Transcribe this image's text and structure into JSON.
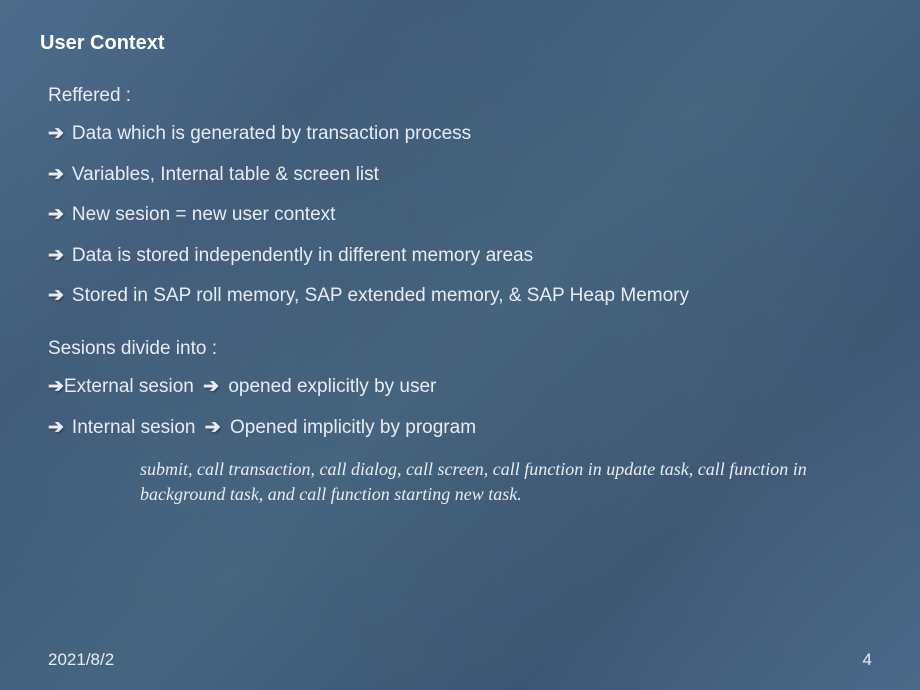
{
  "title": "User Context",
  "section1": {
    "heading": "Reffered :",
    "items": [
      "Data which is generated by transaction process",
      "Variables, Internal table & screen list",
      "New sesion = new user context",
      "Data is stored independently in different memory areas",
      "Stored in SAP roll memory, SAP extended memory, & SAP Heap Memory"
    ]
  },
  "section2": {
    "heading": "Sesions divide into :",
    "items": [
      {
        "label": "External sesion",
        "desc": "opened explicitly by user",
        "leading_space": false
      },
      {
        "label": "Internal sesion",
        "desc": "Opened implicitly by program",
        "leading_space": true
      }
    ]
  },
  "note": "submit, call transaction, call dialog, call screen, call function in update task,  call function in background task, and call function starting new task.",
  "footer": {
    "date": "2021/8/2",
    "page": "4"
  },
  "glyphs": {
    "arrow": "➔"
  }
}
